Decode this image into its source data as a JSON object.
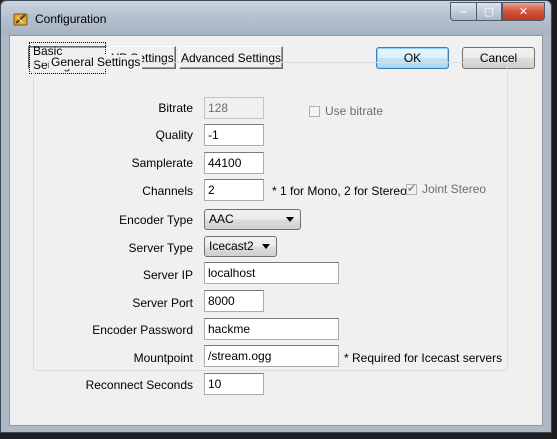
{
  "window": {
    "title": "Configuration",
    "controls": {
      "minimize": "‒",
      "maximize": "▢",
      "close": "✕"
    }
  },
  "tabs": [
    {
      "label": "Basic Settings",
      "active": true
    },
    {
      "label": "YP Settings",
      "active": false
    },
    {
      "label": "Advanced Settings",
      "active": false
    }
  ],
  "buttons": {
    "ok": "OK",
    "cancel": "Cancel"
  },
  "general_settings": {
    "group_label": "General Settings",
    "bitrate": {
      "label": "Bitrate",
      "value": "128",
      "enabled": false
    },
    "use_bitrate": {
      "label": "Use bitrate",
      "checked": false,
      "enabled": false
    },
    "quality": {
      "label": "Quality",
      "value": "-1"
    },
    "samplerate": {
      "label": "Samplerate",
      "value": "44100"
    },
    "channels": {
      "label": "Channels",
      "value": "2",
      "note": "* 1 for Mono, 2 for Stereo"
    },
    "joint_stereo": {
      "label": "Joint Stereo",
      "checked": true,
      "enabled": false
    },
    "encoder_type": {
      "label": "Encoder Type",
      "value": "AAC"
    },
    "server_type": {
      "label": "Server Type",
      "value": "Icecast2"
    },
    "server_ip": {
      "label": "Server IP",
      "value": "localhost"
    },
    "server_port": {
      "label": "Server Port",
      "value": "8000"
    },
    "encoder_password": {
      "label": "Encoder Password",
      "value": "hackme"
    },
    "mountpoint": {
      "label": "Mountpoint",
      "value": "/stream.ogg",
      "note": "* Required for Icecast servers"
    },
    "reconnect_seconds": {
      "label": "Reconnect Seconds",
      "value": "10"
    }
  }
}
